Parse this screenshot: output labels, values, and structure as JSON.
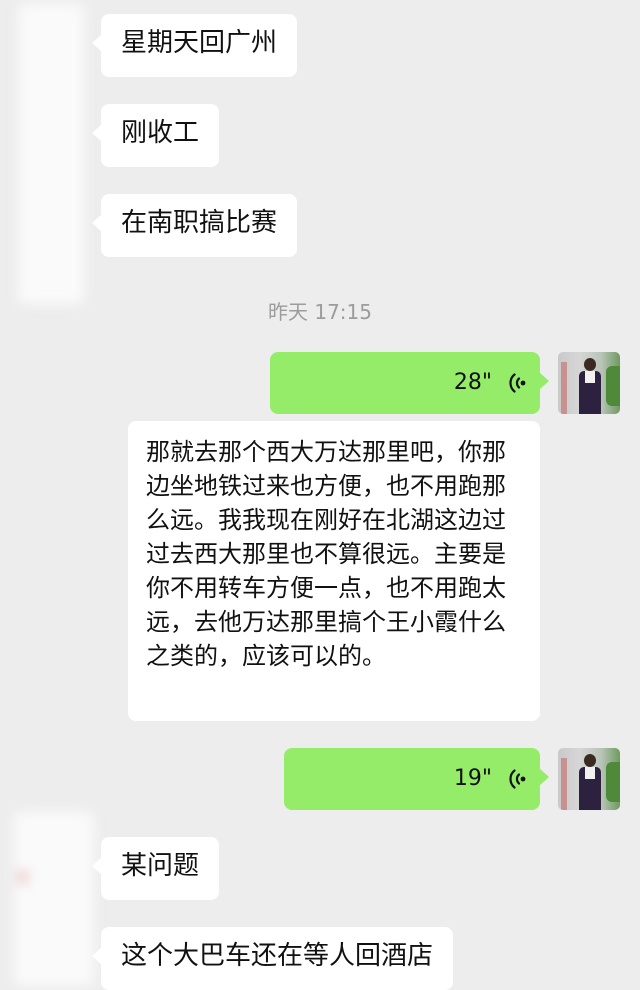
{
  "messages": {
    "m1": "星期天回广州",
    "m2": "刚收工",
    "m3": "在南职搞比赛",
    "m4": "某问题",
    "m5": "这个大巴车还在等人回酒店"
  },
  "timestamp": "昨天 17:15",
  "voice1": {
    "duration": "28\"",
    "transcript": "那就去那个西大万达那里吧，你那边坐地铁过来也方便，也不用跑那么远。我我现在刚好在北湖这边过过去西大那里也不算很远。主要是你不用转车方便一点，也不用跑太远，去他万达那里搞个王小霞什么之类的，应该可以的。"
  },
  "voice2": {
    "duration": "19\""
  },
  "colors": {
    "background": "#ededed",
    "sent_bubble": "#95ec69",
    "received_bubble": "#ffffff",
    "timestamp": "#9c9c9c"
  },
  "icons": {
    "voice": "voice-wave-icon",
    "avatar": "contact-avatar"
  }
}
